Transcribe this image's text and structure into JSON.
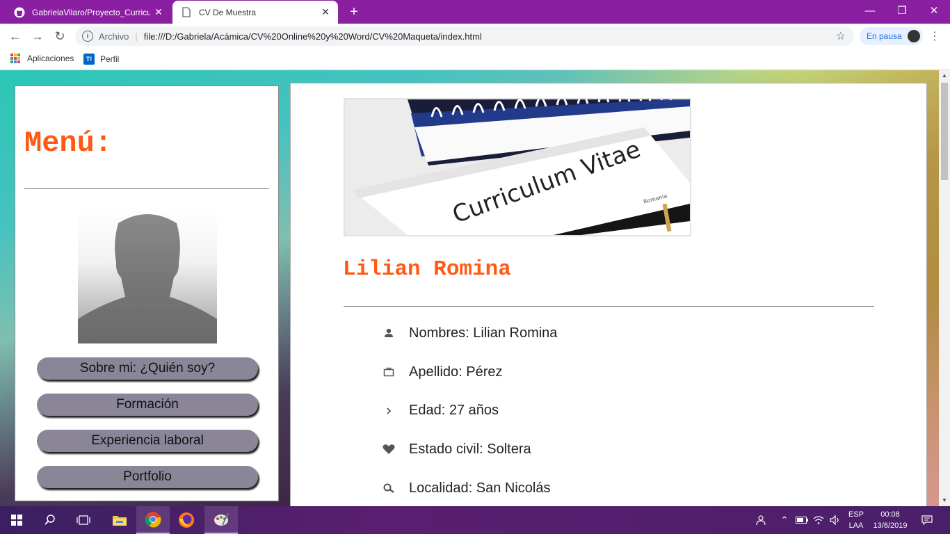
{
  "browser": {
    "tabs": [
      {
        "title": "GabrielaVilaro/Proyecto_Curriculum",
        "icon": "github-icon",
        "active": false
      },
      {
        "title": "CV De Muestra",
        "icon": "page-icon",
        "active": true
      }
    ],
    "address": {
      "scheme_label": "Archivo",
      "url": "file:///D:/Gabriela/Acámica/CV%20Online%20y%20Word/CV%20Maqueta/index.html"
    },
    "profile_label": "En pausa",
    "bookmarks": [
      {
        "label": "Aplicaciones",
        "icon": "apps-grid-icon"
      },
      {
        "label": "Perfil",
        "icon": "trello-icon"
      }
    ]
  },
  "page": {
    "menu_title": "Menú:",
    "nav_buttons": [
      "Sobre mi: ¿Quién soy?",
      "Formación",
      "Experiencia laboral",
      "Portfolio"
    ],
    "cv_image_text": "Curriculum Vitae",
    "cv_image_small_text": "Romania",
    "name": "Lilian Romina",
    "details": [
      {
        "icon": "person-icon",
        "text": "Nombres: Lilian Romina"
      },
      {
        "icon": "briefcase-icon",
        "text": "Apellido: Pérez"
      },
      {
        "icon": "chevron-right-icon",
        "text": "Edad: 27 años"
      },
      {
        "icon": "heart-icon",
        "text": "Estado civil: Soltera"
      },
      {
        "icon": "search-icon",
        "text": "Localidad: San Nicolás"
      }
    ]
  },
  "taskbar": {
    "lang_line1": "ESP",
    "lang_line2": "LAA",
    "time": "00:08",
    "date": "13/6/2019"
  },
  "colors": {
    "accent_orange": "#ff5a14",
    "nav_button_bg": "#8a8698",
    "tabstrip": "#8a1fa1"
  }
}
